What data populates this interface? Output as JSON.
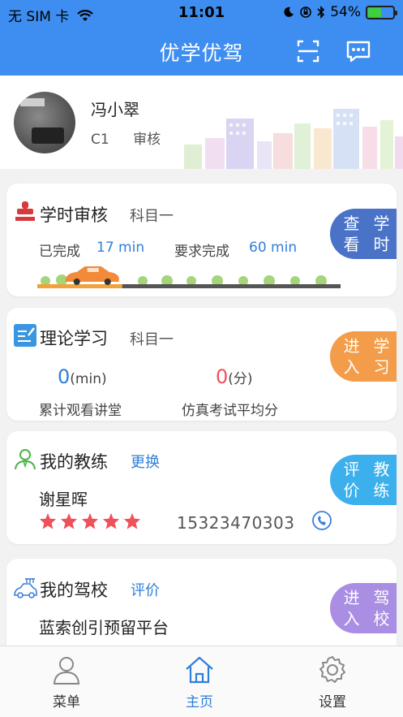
{
  "status_bar": {
    "carrier": "无 SIM 卡",
    "time": "11:01",
    "battery": "54%"
  },
  "nav": {
    "title": "优学优驾",
    "scan_icon": "scan-icon",
    "message_icon": "message-icon"
  },
  "profile": {
    "name": "冯小翠",
    "license": "C1",
    "status": "审核"
  },
  "study_hours": {
    "title": "学时审核",
    "subject": "科目一",
    "completed_label": "已完成",
    "completed_value": "17 min",
    "required_label": "要求完成",
    "required_value": "60 min",
    "progress_fraction": 0.28,
    "button": [
      "查看",
      "学时"
    ],
    "color": "#4a73c7"
  },
  "theory": {
    "title": "理论学习",
    "subject": "科目一",
    "watch_value": "0",
    "watch_unit": "(min)",
    "watch_label": "累计观看讲堂",
    "exam_value": "0",
    "exam_unit": "(分)",
    "exam_label": "仿真考试平均分",
    "button": [
      "进入",
      "学习"
    ],
    "color": "#f39c4a"
  },
  "coach": {
    "title": "我的教练",
    "action": "更换",
    "name": "谢星晖",
    "rating": 5,
    "phone": "15323470303",
    "button": [
      "评价",
      "教练"
    ],
    "color": "#3bb0ec"
  },
  "school": {
    "title": "我的驾校",
    "action": "评价",
    "name": "蓝索创引预留平台",
    "button": [
      "进入",
      "驾校"
    ],
    "color": "#a98ee3"
  },
  "tabs": [
    {
      "label": "菜单",
      "icon": "user-icon"
    },
    {
      "label": "主页",
      "icon": "home-icon",
      "active": true
    },
    {
      "label": "设置",
      "icon": "gear-icon"
    }
  ],
  "colors": {
    "primary": "#3d8ef0",
    "star": "#f0505c",
    "link": "#2f7fd9"
  }
}
